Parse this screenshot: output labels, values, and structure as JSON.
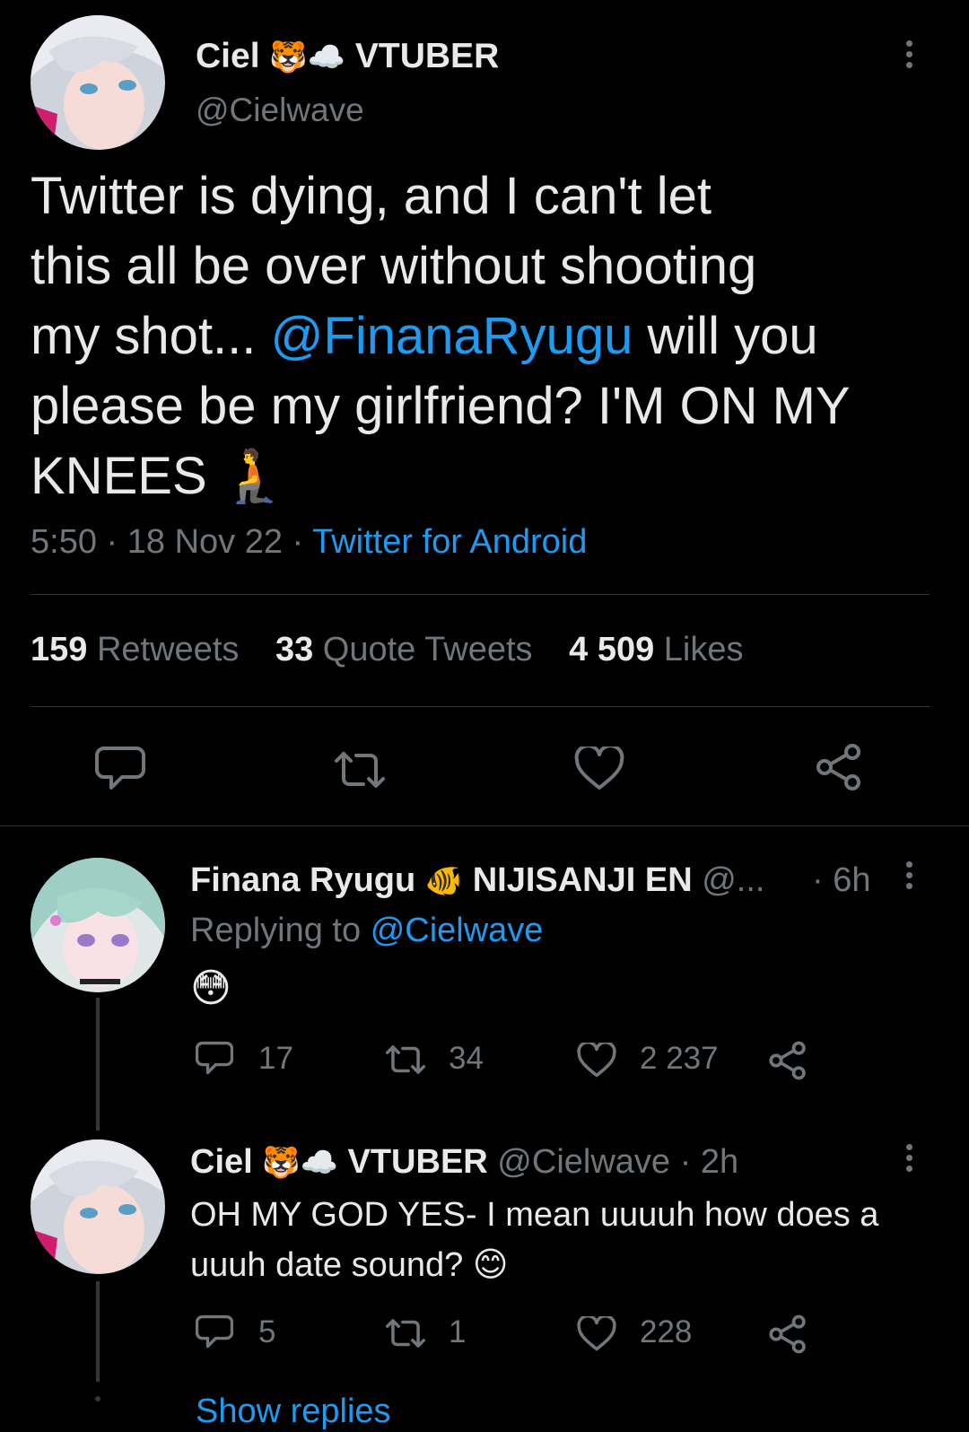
{
  "main_tweet": {
    "author_name": "Ciel",
    "author_badge_emoji": "🐯☁️",
    "author_label": "VTUBER",
    "handle": "@Cielwave",
    "text_lines": [
      "Twitter is dying, and I can't let",
      "this all be over without shooting",
      "my shot... ",
      "@FinanaRyugu",
      " will you",
      "please be my girlfriend? I'M ON MY",
      "KNEES 🧎"
    ],
    "time": "5:50",
    "date": "18 Nov 22",
    "source": "Twitter for Android",
    "stats": {
      "retweets_count": "159",
      "retweets_label": "Retweets",
      "quotes_count": "33",
      "quotes_label": "Quote Tweets",
      "likes_count": "4 509",
      "likes_label": "Likes"
    }
  },
  "reply1": {
    "author_name": "Finana Ryugu",
    "author_badge_emoji": "🐠",
    "author_label": "NIJISANJI EN",
    "handle": "@...",
    "time": "· 6h",
    "replying_prefix": "Replying to",
    "replying_handle": "@Cielwave",
    "text": "😳",
    "replies": "17",
    "retweets": "34",
    "likes": "2 237"
  },
  "reply2": {
    "author_name": "Ciel",
    "author_badge_emoji": "🐯☁️",
    "author_label": "VTUBER",
    "handle": "@Cielwave",
    "time": "· 2h",
    "text_line1": "OH MY GOD YES- I mean uuuuh how does a",
    "text_line2": "uuuh date sound? 😊",
    "replies": "5",
    "retweets": "1",
    "likes": "228"
  },
  "show_replies": "Show replies",
  "colors": {
    "background": "#000000",
    "text": "#e7e9ea",
    "muted": "#71767b",
    "accent": "#1d9bf0"
  }
}
